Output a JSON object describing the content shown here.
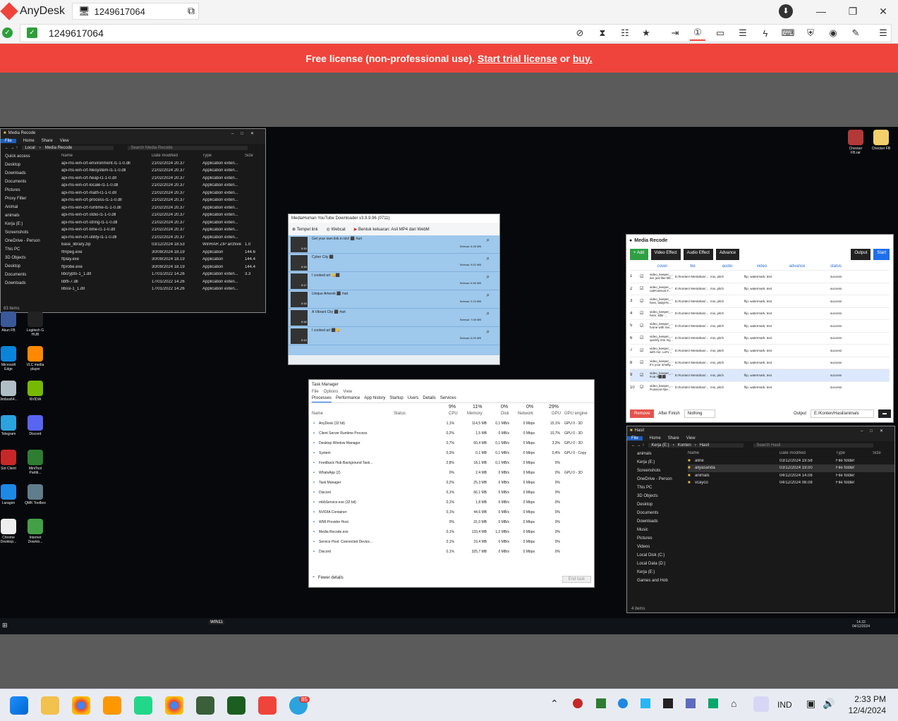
{
  "anydesk": {
    "app_name": "AnyDesk",
    "tab_address": "1249617064",
    "address": "1249617064",
    "banner": {
      "prefix": "Free license (non-professional use).",
      "trial": "Start trial license",
      "or": "or",
      "buy": "buy."
    },
    "brand_color": "#ef443b"
  },
  "remote": {
    "explorer1": {
      "title": "Media Recode",
      "ribbon": [
        "File",
        "Home",
        "Share",
        "View"
      ],
      "path": [
        "Local",
        "Media Recode"
      ],
      "search_placeholder": "Search Media Recode",
      "columns": [
        "Name",
        "Date modified",
        "Type",
        "Size"
      ],
      "nav": [
        "Quick access",
        "Desktop",
        "Downloads",
        "Documents",
        "Pictures",
        "Proxy Filter",
        "Animal",
        "animals",
        "Kerja (E:)",
        "Screenshots",
        "OneDrive - Person",
        "This PC",
        "3D Objects",
        "Desktop",
        "Documents",
        "Downloads"
      ],
      "files": [
        [
          "api-ms-win-crt-environment-l1-1-0.dll",
          "21/02/2024 20.37",
          "Application exten...",
          ""
        ],
        [
          "api-ms-win-crt-filesystem-l1-1-0.dll",
          "21/02/2024 20.37",
          "Application exten...",
          ""
        ],
        [
          "api-ms-win-crt-heap-l1-1-0.dll",
          "21/02/2024 20.37",
          "Application exten...",
          ""
        ],
        [
          "api-ms-win-crt-locale-l1-1-0.dll",
          "21/02/2024 20.37",
          "Application exten...",
          ""
        ],
        [
          "api-ms-win-crt-math-l1-1-0.dll",
          "21/02/2024 20.37",
          "Application exten...",
          ""
        ],
        [
          "api-ms-win-crt-process-l1-1-0.dll",
          "21/02/2024 20.37",
          "Application exten...",
          ""
        ],
        [
          "api-ms-win-crt-runtime-l1-1-0.dll",
          "21/02/2024 20.37",
          "Application exten...",
          ""
        ],
        [
          "api-ms-win-crt-stdio-l1-1-0.dll",
          "21/02/2024 20.37",
          "Application exten...",
          ""
        ],
        [
          "api-ms-win-crt-string-l1-1-0.dll",
          "21/02/2024 20.37",
          "Application exten...",
          ""
        ],
        [
          "api-ms-win-crt-time-l1-1-0.dll",
          "21/02/2024 20.37",
          "Application exten...",
          ""
        ],
        [
          "api-ms-win-crt-utility-l1-1-0.dll",
          "21/02/2024 20.37",
          "Application exten...",
          ""
        ],
        [
          "base_library.zip",
          "03/12/2024 18.53",
          "WinRAR ZIP archive",
          "1.0"
        ],
        [
          "ffmpeg.exe",
          "30/09/2024 18.19",
          "Application",
          "144.6"
        ],
        [
          "ffplay.exe",
          "30/09/2024 18.19",
          "Application",
          "144.4"
        ],
        [
          "ffprobe.exe",
          "30/09/2024 18.19",
          "Application",
          "144.4"
        ],
        [
          "libcrypto-1_1.dll",
          "17/01/2022 14.26",
          "Application exten...",
          "3.3"
        ],
        [
          "libffi-7.dll",
          "17/01/2022 14.26",
          "Application exten...",
          ""
        ],
        [
          "libssl-1_1.dll",
          "17/01/2022 14.26",
          "Application exten...",
          ""
        ]
      ],
      "status": "83 items"
    },
    "ytd": {
      "title": "MediaHuman YouTube Downloader v3.9.9.96 (0711)",
      "paste": "Tempel link",
      "webcam": "Webcat",
      "output": "Bentuk keluaran: Asli MP4 dari WebM",
      "items": [
        {
          "title": "Get your own link in bio! ⬛ #art",
          "dur": "0:15",
          "status": "Selesai: 6.28 MB"
        },
        {
          "title": "Cyber City ⬛",
          "dur": "0:16",
          "status": "Selesai: 9.52 MB"
        },
        {
          "title": "I cooked art 😋⬛",
          "dur": "0:17",
          "status": "Selesai: 6.56 MB"
        },
        {
          "title": "Unique Artwork ⬛ #art",
          "dur": "0:15",
          "status": "Selesai: 9.23 MB"
        },
        {
          "title": "A Vibrant City ⬛ #art",
          "dur": "0:16",
          "status": "Selesai: 7.08 MB"
        },
        {
          "title": "I cooked art ⬛😋",
          "dur": "0:13",
          "status": "Selesai: 6.09 MB"
        }
      ]
    },
    "media_recode": {
      "title": "Media Recode",
      "buttons": [
        "+ Add",
        "Video Effect",
        "Audio Effect",
        "Advance"
      ],
      "output_btn": "Output",
      "start_btn": "Start",
      "columns": [
        "",
        "",
        "cover",
        "file",
        "audio",
        "video",
        "advance",
        "status"
      ],
      "rows": [
        [
          "1",
          "video_keeper_... are just like littl...",
          "E:/Konten/ Mentahan/...",
          "mix, pitch",
          "flip, watermark, text",
          "success"
        ],
        [
          "2",
          "video_keeper_... cat#cutecat #...",
          "E:/Konten/ Mentahan/...",
          "mix, pitch",
          "flip, watermark, text",
          "success"
        ],
        [
          "3",
          "video_keeper_... here, baby!#c...",
          "E:/Konten/ Mentahan/...",
          "mix, pitch",
          "flip, watermark, text",
          "success"
        ],
        [
          "4",
          "video_keeper_... here, little ...",
          "E:/Konten/ Mentahan/...",
          "mix, pitch",
          "flip, watermark, text",
          "success"
        ],
        [
          "5",
          "video_keeper_... home with me...",
          "E:/Konten/ Mentahan/...",
          "mix, pitch",
          "flip, watermark, text",
          "success"
        ],
        [
          "6",
          "video_keeper_... quickly into my...",
          "E:/Konten/ Mentahan/...",
          "mix, pitch",
          "flip, watermark, text",
          "success"
        ],
        [
          "7",
          "video_keeper_... with me. Let's ...",
          "E:/Konten/ Mentahan/...",
          "mix, pitch",
          "flip, watermark, text",
          "success"
        ],
        [
          "8",
          "video_keeper_... It's your smelly...",
          "E:/Konten/ Mentahan/...",
          "mix, pitch",
          "flip, watermark, text",
          "success"
        ],
        [
          "9",
          "video_keeper_... #cat #⬛⬛",
          "E:/Konten/ Mentahan/...",
          "mix, pitch",
          "flip, watermark, text",
          "success"
        ],
        [
          "10",
          "video_keeper_... #cutecat #pe...",
          "E:/Konten/ Mentahan/...",
          "mix, pitch",
          "flip, watermark, text",
          "success"
        ]
      ],
      "remove": "Remove",
      "after_finish_label": "After Finish",
      "after_finish_value": "Nothing",
      "output_label": "Output",
      "output_value": "E:/Konten/Hasil/animals"
    },
    "task_manager": {
      "title": "Task Manager",
      "menu": [
        "File",
        "Options",
        "View"
      ],
      "tabs": [
        "Processes",
        "Performance",
        "App history",
        "Startup",
        "Users",
        "Details",
        "Services"
      ],
      "headers": {
        "name": "Name",
        "status": "Status",
        "cpu_pct": "9%",
        "cpu": "CPU",
        "mem_pct": "11%",
        "mem": "Memory",
        "disk_pct": "0%",
        "disk": "Disk",
        "net_pct": "0%",
        "net": "Network",
        "gpu_pct": "29%",
        "gpu": "GPU",
        "gpu_engine": "GPU engine"
      },
      "rows": [
        [
          "AnyDesk (32 bit)",
          "1,1%",
          "114,5 MB",
          "0,1 MB/s",
          "0 Mbps",
          "15,1%",
          "GPU 0 - 3D"
        ],
        [
          "Client Server Runtime Process",
          "0,2%",
          "1,5 MB",
          "0 MB/s",
          "0 Mbps",
          "10,7%",
          "GPU 0 - 3D"
        ],
        [
          "Desktop Window Manager",
          "0,7%",
          "60,4 MB",
          "0,1 MB/s",
          "0 Mbps",
          "3,3%",
          "GPU 0 - 3D"
        ],
        [
          "System",
          "0,3%",
          "0,1 MB",
          "0,1 MB/s",
          "0 Mbps",
          "0,4%",
          "GPU 0 - Copy"
        ],
        [
          "Feedback Hub Background Task...",
          "2,8%",
          "18,1 MB",
          "0,1 MB/s",
          "0 Mbps",
          "0%",
          ""
        ],
        [
          "WhatsApp (2)",
          "0%",
          "2,4 MB",
          "0 MB/s",
          "0 Mbps",
          "0%",
          "GPU 0 - 3D"
        ],
        [
          "Task Manager",
          "0,2%",
          "25,3 MB",
          "0 MB/s",
          "0 Mbps",
          "0%",
          ""
        ],
        [
          "Discord",
          "0,1%",
          "66,1 MB",
          "0 MB/s",
          "0 Mbps",
          "0%",
          ""
        ],
        [
          "mbbService.exe (32 bit)",
          "0,1%",
          "1,8 MB",
          "0 MB/s",
          "0 Mbps",
          "0%",
          ""
        ],
        [
          "NVIDIA Container",
          "0,1%",
          "44,6 MB",
          "0 MB/s",
          "0 Mbps",
          "0%",
          ""
        ],
        [
          "WMI Provider Host",
          "0%",
          "31,0 MB",
          "0 MB/s",
          "0 Mbps",
          "0%",
          ""
        ],
        [
          "Media Recode.exe",
          "0,1%",
          "133,4 MB",
          "1,2 MB/s",
          "0 Mbps",
          "0%",
          ""
        ],
        [
          "Service Host: Connected Device...",
          "0,1%",
          "10,4 MB",
          "0 MB/s",
          "0 Mbps",
          "0%",
          ""
        ],
        [
          "Discord",
          "0,1%",
          "325,7 MB",
          "0 MB/s",
          "0 Mbps",
          "0%",
          ""
        ]
      ],
      "fewer": "Fewer details",
      "end_task": "End task"
    },
    "explorer2": {
      "title": "Hasil",
      "ribbon": [
        "File",
        "Home",
        "Share",
        "View"
      ],
      "path": [
        "Kerja (E:)",
        "Konten",
        "Hasil"
      ],
      "search_placeholder": "Search Hasil",
      "columns": [
        "Name",
        "Date modified",
        "Type",
        "Size"
      ],
      "nav": [
        "animals",
        "Kerja (E:)",
        "Screenshots",
        "OneDrive - Person",
        "This PC",
        "3D Objects",
        "Desktop",
        "Documents",
        "Downloads",
        "Music",
        "Pictures",
        "Videos",
        "Local Disk (C:)",
        "Local Data (D:)",
        "Kerja (E:)",
        "Games and Hob"
      ],
      "files": [
        [
          "aline",
          "03/12/2024 19.58",
          "File folder"
        ],
        [
          "aliyasanda",
          "03/12/2024 19.00",
          "File folder"
        ],
        [
          "animals",
          "04/12/2024 14.08",
          "File folder"
        ],
        [
          "vcayco",
          "04/12/2024 08.08",
          "File folder"
        ]
      ],
      "status": "4 items"
    },
    "desktop_icons": [
      "Akun FB",
      "Logitech G HUB",
      "Microsoft Edge",
      "VLC media player",
      "Jimbos64...",
      "NVIDIA",
      "Telegram",
      "Discord",
      "Sot Client",
      "MiniTool Partiti...",
      "Laragon",
      "QMK Toolbox",
      "Chrome Desktop...",
      "Internet Downlo..."
    ],
    "desktop_icons_right": [
      "Checker FB.rar",
      "Checker FB"
    ],
    "taskbar": {
      "time": "14.33",
      "date": "04/12/2024",
      "win11": "WIN11"
    }
  },
  "local_taskbar": {
    "lang": "IND",
    "time": "2:33 PM",
    "date": "12/4/2024",
    "telegram_badge": "85"
  }
}
